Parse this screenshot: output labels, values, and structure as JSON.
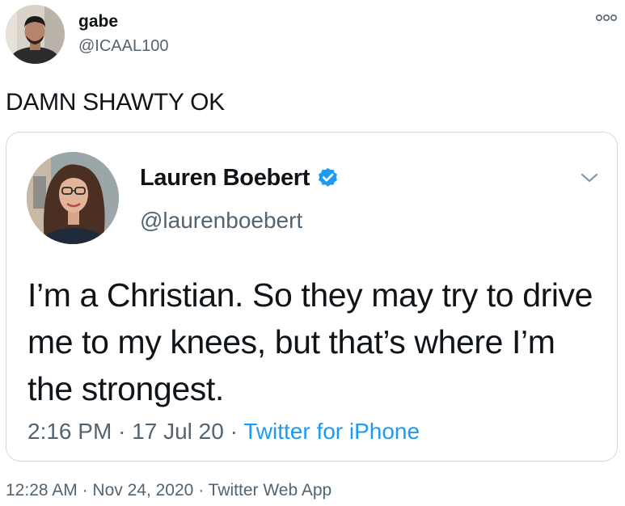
{
  "author": {
    "name": "gabe",
    "handle": "@ICAAL100",
    "avatar_icon": "user-photo-avatar"
  },
  "tweet": {
    "text": "DAMN SHAWTY OK",
    "time": "12:28 AM",
    "date": "Nov 24, 2020",
    "source": "Twitter Web App",
    "separator": "·"
  },
  "quoted": {
    "name": "Lauren Boebert",
    "handle": "@laurenboebert",
    "verified_icon": "verified-badge-icon",
    "text": "I’m a Christian. So they may try to drive me to my knees, but that’s where I’m the strongest.",
    "time": "2:16 PM",
    "date": "17 Jul 20",
    "source": "Twitter for iPhone",
    "separator": "·"
  },
  "colors": {
    "text_primary": "#0f1419",
    "text_secondary": "#536471",
    "accent": "#1d9bf0",
    "border": "#cfd9de"
  },
  "icons": {
    "more": "more-options-icon",
    "caret": "chevron-down-icon"
  }
}
